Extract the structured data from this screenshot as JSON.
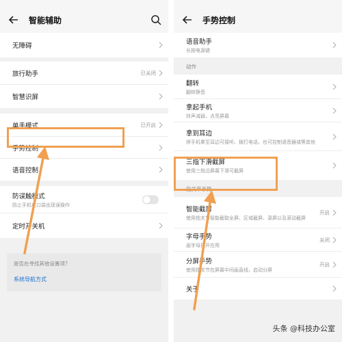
{
  "left": {
    "title": "智能辅助",
    "groups": [
      [
        {
          "label": "无障碍"
        }
      ],
      [
        {
          "label": "旅行助手",
          "value": "已关闭"
        },
        {
          "label": "智慧识屏"
        }
      ],
      [
        {
          "label": "单手模式",
          "value": "已开启"
        },
        {
          "label": "手势控制"
        },
        {
          "label": "语音控制"
        }
      ],
      [
        {
          "label": "防误触模式",
          "sub": "防止手机在口袋出现误操作"
        },
        {
          "label": "定时开关机"
        }
      ]
    ],
    "suggest_question": "是否在寻找其他设置项？",
    "suggest_link": "系统导航方式"
  },
  "right": {
    "title": "手势控制",
    "top_item": {
      "label": "语音助手",
      "sub": "长按电源键"
    },
    "section_actions": "动作",
    "actions": [
      {
        "label": "翻转",
        "sub": "翻转静音"
      },
      {
        "label": "拿起手机",
        "sub": "铃声减弱，点亮屏幕"
      },
      {
        "label": "拿到耳边",
        "sub": "将手机拿至耳边可接听、拨打电话，也可控制语音器或等其他"
      },
      {
        "label": "三指下滑截屏",
        "sub": "使用三指沿屏幕下滑可截屏"
      }
    ],
    "section_knuckle": "指关节手势",
    "knuckle": [
      {
        "label": "智能截屏",
        "sub": "使用指关节智能截取全屏、区域截屏、录屏以及滚动截屏",
        "value": "开启"
      },
      {
        "label": "字母手势",
        "sub": "画字母打开应用",
        "value": "关闭"
      },
      {
        "label": "分屏手势",
        "sub": "使用指关节在屏幕中间画直线，启动分屏",
        "value": "开启"
      }
    ],
    "about": "关于"
  },
  "watermark": "头条 @科技办公室",
  "colors": {
    "highlight": "#f0a050",
    "link": "#1a6fd0",
    "background": "#f1f1f1"
  }
}
